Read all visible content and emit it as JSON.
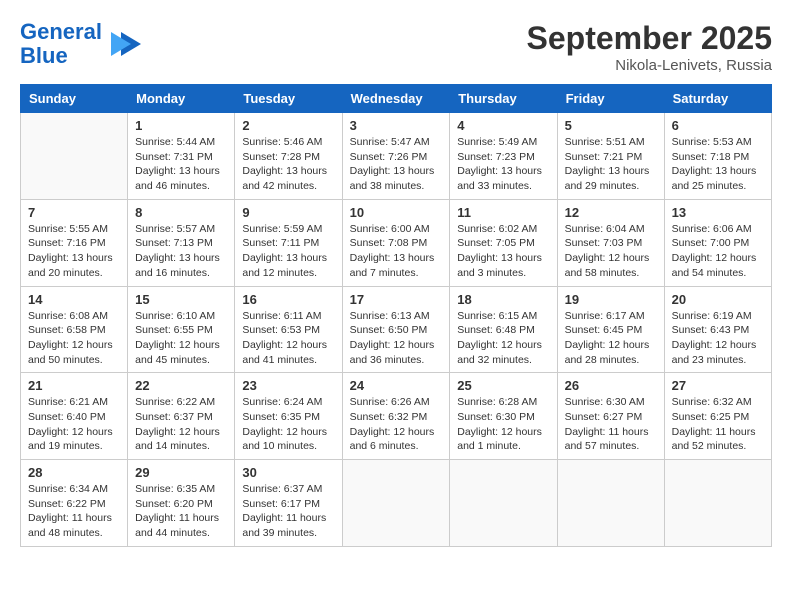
{
  "header": {
    "logo_line1": "General",
    "logo_line2": "Blue",
    "month": "September 2025",
    "location": "Nikola-Lenivets, Russia"
  },
  "days_of_week": [
    "Sunday",
    "Monday",
    "Tuesday",
    "Wednesday",
    "Thursday",
    "Friday",
    "Saturday"
  ],
  "weeks": [
    [
      {
        "day": "",
        "info": ""
      },
      {
        "day": "1",
        "info": "Sunrise: 5:44 AM\nSunset: 7:31 PM\nDaylight: 13 hours\nand 46 minutes."
      },
      {
        "day": "2",
        "info": "Sunrise: 5:46 AM\nSunset: 7:28 PM\nDaylight: 13 hours\nand 42 minutes."
      },
      {
        "day": "3",
        "info": "Sunrise: 5:47 AM\nSunset: 7:26 PM\nDaylight: 13 hours\nand 38 minutes."
      },
      {
        "day": "4",
        "info": "Sunrise: 5:49 AM\nSunset: 7:23 PM\nDaylight: 13 hours\nand 33 minutes."
      },
      {
        "day": "5",
        "info": "Sunrise: 5:51 AM\nSunset: 7:21 PM\nDaylight: 13 hours\nand 29 minutes."
      },
      {
        "day": "6",
        "info": "Sunrise: 5:53 AM\nSunset: 7:18 PM\nDaylight: 13 hours\nand 25 minutes."
      }
    ],
    [
      {
        "day": "7",
        "info": "Sunrise: 5:55 AM\nSunset: 7:16 PM\nDaylight: 13 hours\nand 20 minutes."
      },
      {
        "day": "8",
        "info": "Sunrise: 5:57 AM\nSunset: 7:13 PM\nDaylight: 13 hours\nand 16 minutes."
      },
      {
        "day": "9",
        "info": "Sunrise: 5:59 AM\nSunset: 7:11 PM\nDaylight: 13 hours\nand 12 minutes."
      },
      {
        "day": "10",
        "info": "Sunrise: 6:00 AM\nSunset: 7:08 PM\nDaylight: 13 hours\nand 7 minutes."
      },
      {
        "day": "11",
        "info": "Sunrise: 6:02 AM\nSunset: 7:05 PM\nDaylight: 13 hours\nand 3 minutes."
      },
      {
        "day": "12",
        "info": "Sunrise: 6:04 AM\nSunset: 7:03 PM\nDaylight: 12 hours\nand 58 minutes."
      },
      {
        "day": "13",
        "info": "Sunrise: 6:06 AM\nSunset: 7:00 PM\nDaylight: 12 hours\nand 54 minutes."
      }
    ],
    [
      {
        "day": "14",
        "info": "Sunrise: 6:08 AM\nSunset: 6:58 PM\nDaylight: 12 hours\nand 50 minutes."
      },
      {
        "day": "15",
        "info": "Sunrise: 6:10 AM\nSunset: 6:55 PM\nDaylight: 12 hours\nand 45 minutes."
      },
      {
        "day": "16",
        "info": "Sunrise: 6:11 AM\nSunset: 6:53 PM\nDaylight: 12 hours\nand 41 minutes."
      },
      {
        "day": "17",
        "info": "Sunrise: 6:13 AM\nSunset: 6:50 PM\nDaylight: 12 hours\nand 36 minutes."
      },
      {
        "day": "18",
        "info": "Sunrise: 6:15 AM\nSunset: 6:48 PM\nDaylight: 12 hours\nand 32 minutes."
      },
      {
        "day": "19",
        "info": "Sunrise: 6:17 AM\nSunset: 6:45 PM\nDaylight: 12 hours\nand 28 minutes."
      },
      {
        "day": "20",
        "info": "Sunrise: 6:19 AM\nSunset: 6:43 PM\nDaylight: 12 hours\nand 23 minutes."
      }
    ],
    [
      {
        "day": "21",
        "info": "Sunrise: 6:21 AM\nSunset: 6:40 PM\nDaylight: 12 hours\nand 19 minutes."
      },
      {
        "day": "22",
        "info": "Sunrise: 6:22 AM\nSunset: 6:37 PM\nDaylight: 12 hours\nand 14 minutes."
      },
      {
        "day": "23",
        "info": "Sunrise: 6:24 AM\nSunset: 6:35 PM\nDaylight: 12 hours\nand 10 minutes."
      },
      {
        "day": "24",
        "info": "Sunrise: 6:26 AM\nSunset: 6:32 PM\nDaylight: 12 hours\nand 6 minutes."
      },
      {
        "day": "25",
        "info": "Sunrise: 6:28 AM\nSunset: 6:30 PM\nDaylight: 12 hours\nand 1 minute."
      },
      {
        "day": "26",
        "info": "Sunrise: 6:30 AM\nSunset: 6:27 PM\nDaylight: 11 hours\nand 57 minutes."
      },
      {
        "day": "27",
        "info": "Sunrise: 6:32 AM\nSunset: 6:25 PM\nDaylight: 11 hours\nand 52 minutes."
      }
    ],
    [
      {
        "day": "28",
        "info": "Sunrise: 6:34 AM\nSunset: 6:22 PM\nDaylight: 11 hours\nand 48 minutes."
      },
      {
        "day": "29",
        "info": "Sunrise: 6:35 AM\nSunset: 6:20 PM\nDaylight: 11 hours\nand 44 minutes."
      },
      {
        "day": "30",
        "info": "Sunrise: 6:37 AM\nSunset: 6:17 PM\nDaylight: 11 hours\nand 39 minutes."
      },
      {
        "day": "",
        "info": ""
      },
      {
        "day": "",
        "info": ""
      },
      {
        "day": "",
        "info": ""
      },
      {
        "day": "",
        "info": ""
      }
    ]
  ]
}
